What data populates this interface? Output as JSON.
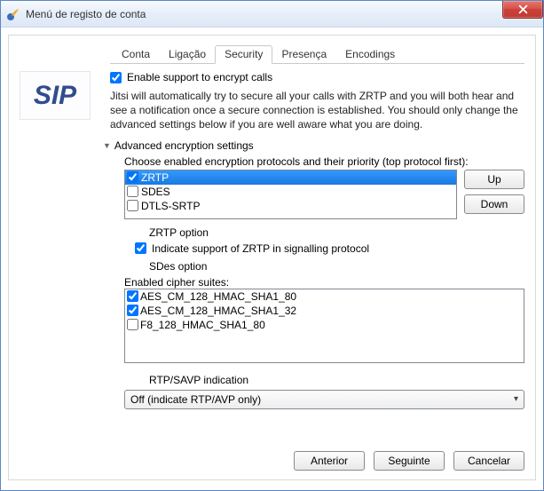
{
  "window": {
    "title": "Menú de registo de conta"
  },
  "tabs": [
    {
      "label": "Conta"
    },
    {
      "label": "Ligação"
    },
    {
      "label": "Security",
      "active": true
    },
    {
      "label": "Presença"
    },
    {
      "label": "Encodings"
    }
  ],
  "logo": "SIP",
  "security": {
    "enable_encrypt_label": "Enable support to encrypt calls",
    "enable_encrypt_checked": true,
    "description": "Jitsi will automatically try to secure all your calls with ZRTP and you will both hear and see a notification once a secure connection is established. You should only change the advanced settings below if you are well aware what you are doing.",
    "advanced_label": "Advanced encryption settings",
    "protocols_label": "Choose enabled encryption protocols and their priority (top protocol first):",
    "protocols": [
      {
        "name": "ZRTP",
        "checked": true,
        "selected": true
      },
      {
        "name": "SDES",
        "checked": false,
        "selected": false
      },
      {
        "name": "DTLS-SRTP",
        "checked": false,
        "selected": false
      }
    ],
    "up_label": "Up",
    "down_label": "Down",
    "zrtp_heading": "ZRTP option",
    "zrtp_indicate_label": "Indicate support of ZRTP in signalling protocol",
    "zrtp_indicate_checked": true,
    "sdes_heading": "SDes option",
    "ciphers_label": "Enabled cipher suites:",
    "ciphers": [
      {
        "name": "AES_CM_128_HMAC_SHA1_80",
        "checked": true
      },
      {
        "name": "AES_CM_128_HMAC_SHA1_32",
        "checked": true
      },
      {
        "name": "F8_128_HMAC_SHA1_80",
        "checked": false
      }
    ],
    "rtp_heading": "RTP/SAVP indication",
    "rtp_value": "Off (indicate RTP/AVP only)"
  },
  "footer": {
    "prev": "Anterior",
    "next": "Seguinte",
    "cancel": "Cancelar"
  }
}
